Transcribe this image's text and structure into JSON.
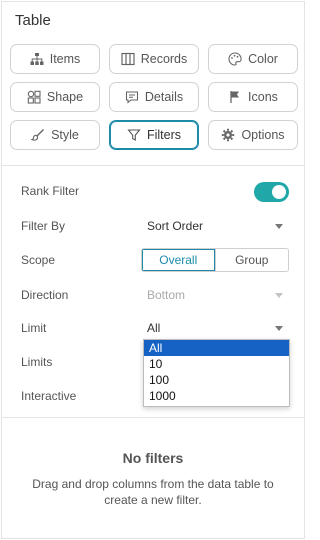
{
  "title": "Table",
  "tabs": [
    {
      "label": "Items",
      "icon": "hierarchy-icon",
      "active": false
    },
    {
      "label": "Records",
      "icon": "columns-icon",
      "active": false
    },
    {
      "label": "Color",
      "icon": "palette-icon",
      "active": false
    },
    {
      "label": "Shape",
      "icon": "shapes-icon",
      "active": false
    },
    {
      "label": "Details",
      "icon": "comment-icon",
      "active": false
    },
    {
      "label": "Icons",
      "icon": "flag-icon",
      "active": false
    },
    {
      "label": "Style",
      "icon": "brush-icon",
      "active": false
    },
    {
      "label": "Filters",
      "icon": "filter-icon",
      "active": true
    },
    {
      "label": "Options",
      "icon": "gear-icon",
      "active": false
    }
  ],
  "settings": {
    "rank_filter_label": "Rank Filter",
    "rank_filter_on": true,
    "filter_by_label": "Filter By",
    "filter_by_value": "Sort Order",
    "scope_label": "Scope",
    "scope_options": [
      "Overall",
      "Group"
    ],
    "scope_selected": "Overall",
    "direction_label": "Direction",
    "direction_value": "Bottom",
    "limit_label": "Limit",
    "limit_value": "All",
    "limits_label": "Limits",
    "interactive_label": "Interactive",
    "limit_options": [
      "All",
      "10",
      "100",
      "1000"
    ],
    "limit_selected": "All"
  },
  "empty_state": {
    "title": "No filters",
    "description": "Drag and drop columns from the data table to create a new filter."
  },
  "colors": {
    "accent": "#1d8aa8",
    "toggle_on": "#1fa8a7",
    "selected_option": "#1662c4"
  }
}
